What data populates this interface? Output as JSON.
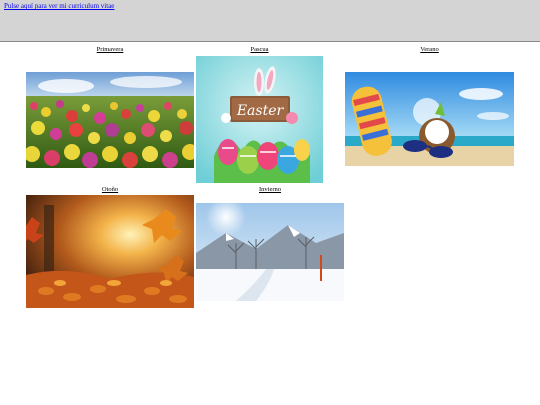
{
  "topbar": {
    "link_text": "Pulse aquí para ver mi curriculum vitae"
  },
  "gallery": [
    {
      "label": "Primavera",
      "icon": "spring-flowers-image"
    },
    {
      "label": "Pascua",
      "icon": "easter-eggs-image",
      "sign_text": "Easter"
    },
    {
      "label": "Verano",
      "icon": "summer-beach-image"
    },
    {
      "label": "Otoño",
      "icon": "autumn-leaves-image"
    },
    {
      "label": "Invierno",
      "icon": "winter-snow-image"
    }
  ]
}
